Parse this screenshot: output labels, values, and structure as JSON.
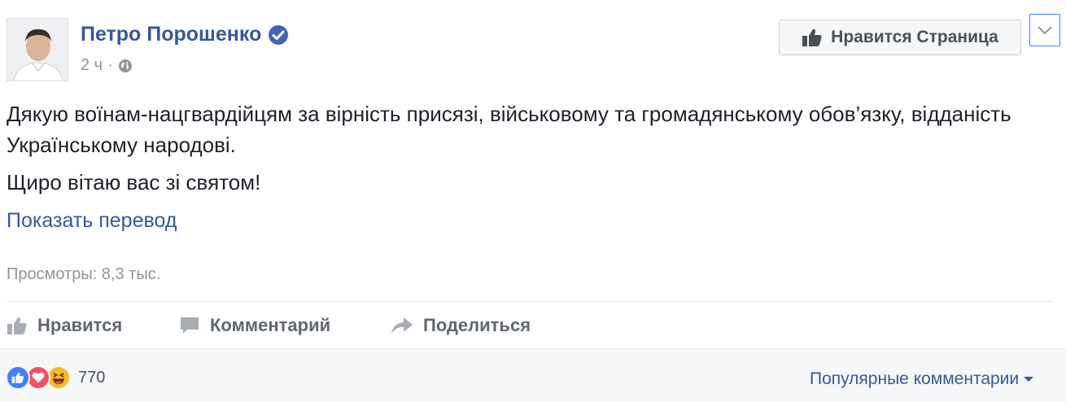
{
  "post": {
    "author": "Петро Порошенко",
    "time": "2 ч",
    "separator": "·",
    "text_paragraphs": [
      "Дякую воїнам-нацгвардійцям за вірність присязі, військовому та громадянському обов’язку, відданість Українському народові.",
      "Щиро вітаю вас зі святом!"
    ],
    "translate_link": "Показать перевод",
    "views": "Просмотры: 8,3 тыс."
  },
  "header": {
    "like_page_label": "Нравится Страница"
  },
  "actions": {
    "like_label": "Нравится",
    "comment_label": "Комментарий",
    "share_label": "Поделиться"
  },
  "footer": {
    "reaction_count": "770",
    "reactions": [
      "like-icon",
      "love-icon",
      "haha-icon"
    ],
    "sort_label": "Популярные комментарии"
  },
  "colors": {
    "link": "#365899",
    "text": "#1d2129",
    "muted": "#90949c",
    "verified": "#4267b2",
    "like_reaction": "#4080ff",
    "love_reaction": "#f25268",
    "haha_reaction": "#f7b928"
  }
}
